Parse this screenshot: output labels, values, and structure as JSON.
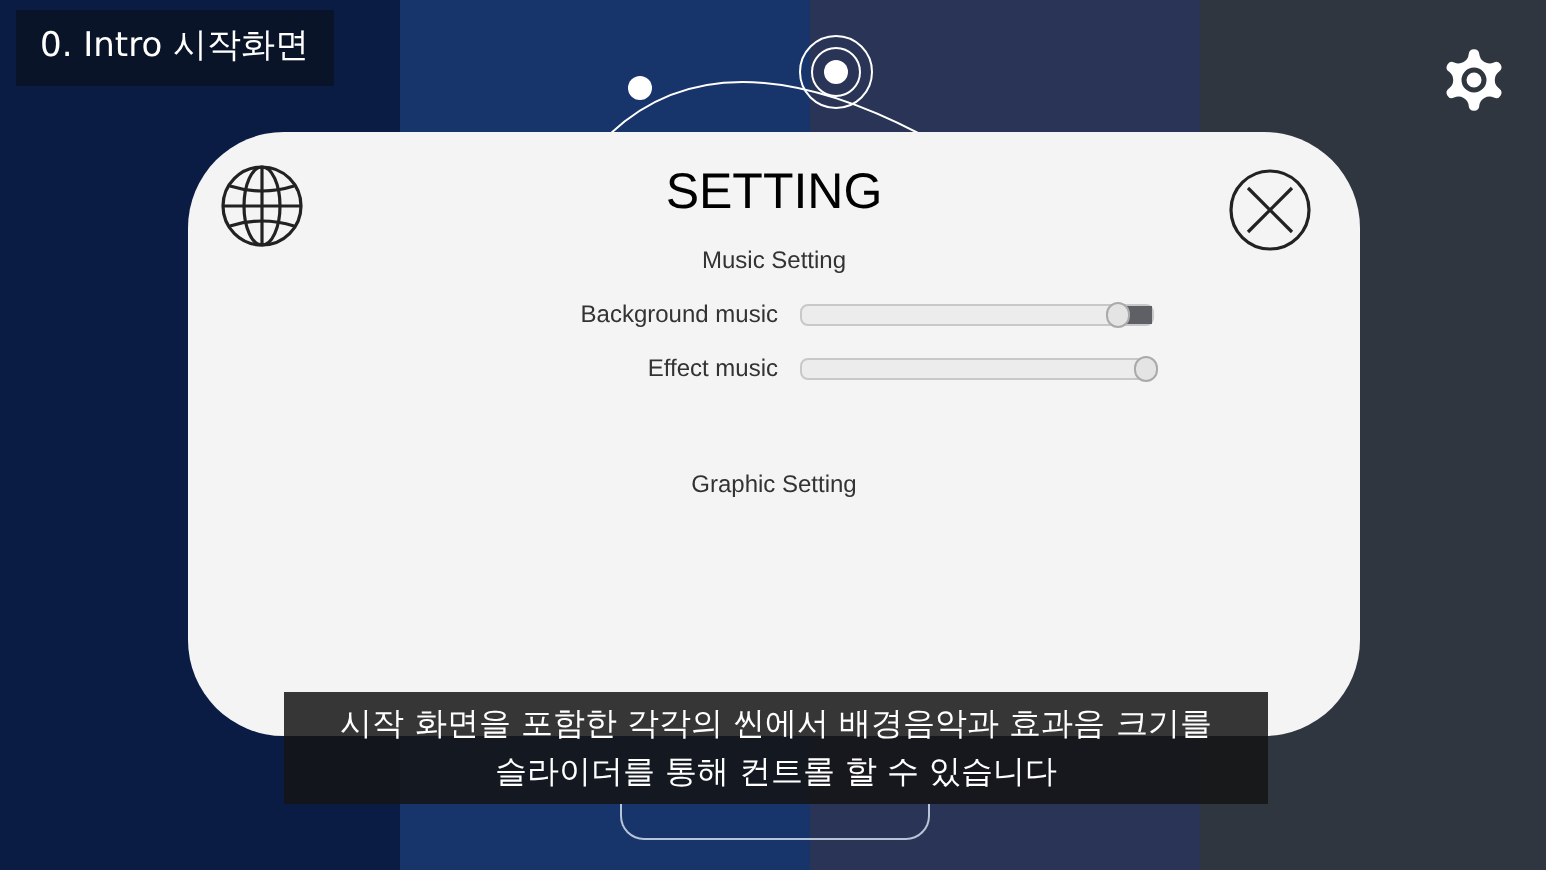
{
  "scene_label": "0. Intro 시작화면",
  "dialog": {
    "title": "SETTING",
    "music_heading": "Music Setting",
    "sliders": [
      {
        "label": "Background music",
        "level": 0.9
      },
      {
        "label": "Effect music",
        "level": 0.98
      }
    ],
    "graphic_heading": "Graphic Setting"
  },
  "caption": [
    "시작 화면을 포함한 각각의 씬에서 배경음악과 효과음 크기를",
    "슬라이더를 통해 컨트롤 할 수 있습니다"
  ]
}
